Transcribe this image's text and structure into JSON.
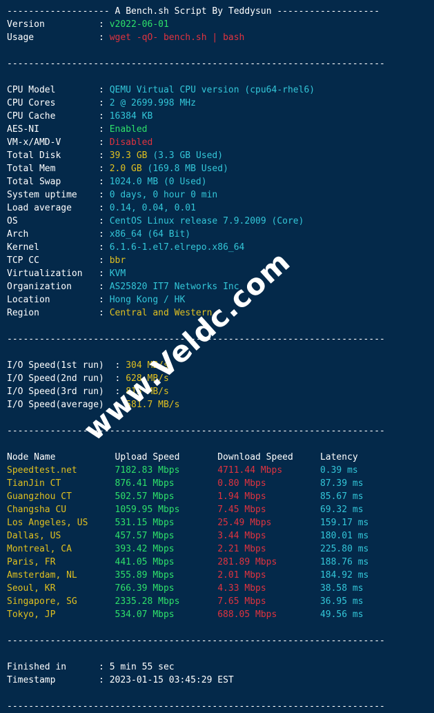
{
  "theme": {
    "background": "#04294a",
    "foreground": "#ffffff",
    "green": "#2ee06a",
    "red": "#e0333f",
    "cyan": "#33c6d8",
    "yellow": "#e0c020"
  },
  "watermark": {
    "text": "www.Veldc.com"
  },
  "header": {
    "dashes_left": "-------------------",
    "title": "A Bench.sh Script By Teddysun",
    "dashes_right": "-------------------",
    "version_label": "Version",
    "version_value": "v2022-06-01",
    "usage_label": "Usage",
    "usage_value": "wget -qO- bench.sh | bash"
  },
  "separator": "----------------------------------------------------------------------",
  "sysinfo": [
    {
      "label": "CPU Model",
      "value": "QEMU Virtual CPU version (cpu64-rhel6)",
      "color": "cyan"
    },
    {
      "label": "CPU Cores",
      "value": "2 @ 2699.998 MHz",
      "color": "cyan"
    },
    {
      "label": "CPU Cache",
      "value": "16384 KB",
      "color": "cyan"
    },
    {
      "label": "AES-NI",
      "value": "Enabled",
      "color": "green"
    },
    {
      "label": "VM-x/AMD-V",
      "value": "Disabled",
      "color": "red"
    },
    {
      "label": "Total Disk",
      "value": "39.3 GB (3.3 GB Used)",
      "color": "yellow-cyan"
    },
    {
      "label": "Total Mem",
      "value": "2.0 GB (169.8 MB Used)",
      "color": "yellow-cyan"
    },
    {
      "label": "Total Swap",
      "value": "1024.0 MB (0 Used)",
      "color": "cyan"
    },
    {
      "label": "System uptime",
      "value": "0 days, 0 hour 0 min",
      "color": "cyan"
    },
    {
      "label": "Load average",
      "value": "0.14, 0.04, 0.01",
      "color": "cyan"
    },
    {
      "label": "OS",
      "value": "CentOS Linux release 7.9.2009 (Core)",
      "color": "cyan"
    },
    {
      "label": "Arch",
      "value": "x86_64 (64 Bit)",
      "color": "cyan"
    },
    {
      "label": "Kernel",
      "value": "6.1.6-1.el7.elrepo.x86_64",
      "color": "cyan"
    },
    {
      "label": "TCP CC",
      "value": "bbr",
      "color": "yellow"
    },
    {
      "label": "Virtualization",
      "value": "KVM",
      "color": "cyan"
    },
    {
      "label": "Organization",
      "value": "AS25820 IT7 Networks Inc",
      "color": "cyan"
    },
    {
      "label": "Location",
      "value": "Hong Kong / HK",
      "color": "cyan"
    },
    {
      "label": "Region",
      "value": "Central and Western",
      "color": "yellow"
    }
  ],
  "sysinfo_split": {
    "total_disk": {
      "primary": "39.3 GB",
      "secondary": "(3.3 GB Used)"
    },
    "total_mem": {
      "primary": "2.0 GB",
      "secondary": "(169.8 MB Used)"
    }
  },
  "io": [
    {
      "label": "I/O Speed(1st run)",
      "value": "304 MB/s"
    },
    {
      "label": "I/O Speed(2nd run)",
      "value": "628 MB/s"
    },
    {
      "label": "I/O Speed(3rd run)",
      "value": "813 MB/s"
    },
    {
      "label": "I/O Speed(average)",
      "value": "581.7 MB/s"
    }
  ],
  "speedtest": {
    "headers": {
      "node": "Node Name",
      "upload": "Upload Speed",
      "download": "Download Speed",
      "latency": "Latency"
    },
    "rows": [
      {
        "node": "Speedtest.net",
        "upload": "7182.83 Mbps",
        "download": "4711.44 Mbps",
        "latency": "0.39 ms"
      },
      {
        "node": "TianJin CT",
        "upload": "876.41 Mbps",
        "download": "0.80 Mbps",
        "latency": "87.39 ms"
      },
      {
        "node": "Guangzhou CT",
        "upload": "502.57 Mbps",
        "download": "1.94 Mbps",
        "latency": "85.67 ms"
      },
      {
        "node": "Changsha CU",
        "upload": "1059.95 Mbps",
        "download": "7.45 Mbps",
        "latency": "69.32 ms"
      },
      {
        "node": "Los Angeles, US",
        "upload": "531.15 Mbps",
        "download": "25.49 Mbps",
        "latency": "159.17 ms"
      },
      {
        "node": "Dallas, US",
        "upload": "457.57 Mbps",
        "download": "3.44 Mbps",
        "latency": "180.01 ms"
      },
      {
        "node": "Montreal, CA",
        "upload": "393.42 Mbps",
        "download": "2.21 Mbps",
        "latency": "225.80 ms"
      },
      {
        "node": "Paris, FR",
        "upload": "441.05 Mbps",
        "download": "281.89 Mbps",
        "latency": "188.76 ms"
      },
      {
        "node": "Amsterdam, NL",
        "upload": "355.89 Mbps",
        "download": "2.01 Mbps",
        "latency": "184.92 ms"
      },
      {
        "node": "Seoul, KR",
        "upload": "766.39 Mbps",
        "download": "4.33 Mbps",
        "latency": "38.58 ms"
      },
      {
        "node": "Singapore, SG",
        "upload": "2335.28 Mbps",
        "download": "7.65 Mbps",
        "latency": "36.95 ms"
      },
      {
        "node": "Tokyo, JP",
        "upload": "534.07 Mbps",
        "download": "688.05 Mbps",
        "latency": "49.56 ms"
      }
    ]
  },
  "footer": {
    "finished_label": "Finished in",
    "finished_value": "5 min 55 sec",
    "timestamp_label": "Timestamp",
    "timestamp_value": "2023-01-15 03:45:29 EST"
  }
}
